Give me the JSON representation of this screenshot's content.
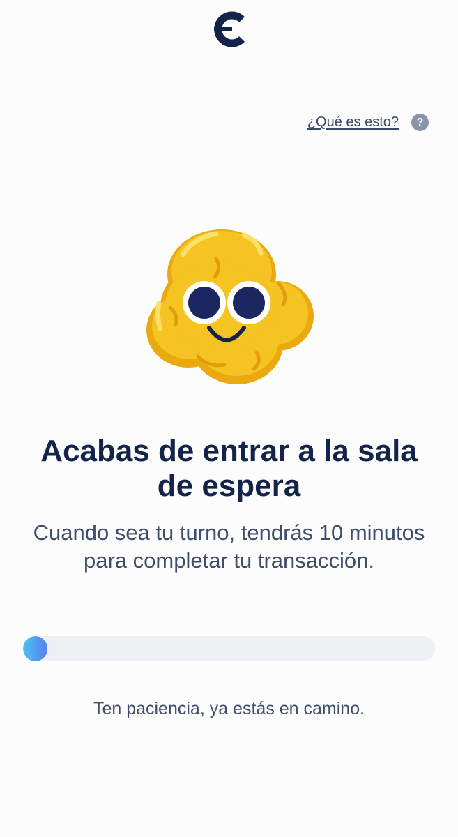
{
  "header": {
    "logo_icon": "brand-c-logo-icon",
    "help_link": "¿Qué es esto?",
    "help_icon": "question-circle-icon",
    "help_icon_glyph": "?"
  },
  "mascot": {
    "icon": "popcorn-smiling-mascot"
  },
  "main": {
    "title": "Acabas de entrar a la sala de espera",
    "subtitle": "Cuando sea tu turno, tendrás 10 minutos para completar tu transacción."
  },
  "progress": {
    "percent": 3
  },
  "footer": {
    "message": "Ten paciencia, ya estás en camino."
  },
  "colors": {
    "navy": "#14234a",
    "text_secondary": "#3d4d6a",
    "progress_start": "#4cc4ef",
    "progress_end": "#5a7df2",
    "track": "#eef0f4",
    "mascot_yellow": "#f5c322"
  }
}
